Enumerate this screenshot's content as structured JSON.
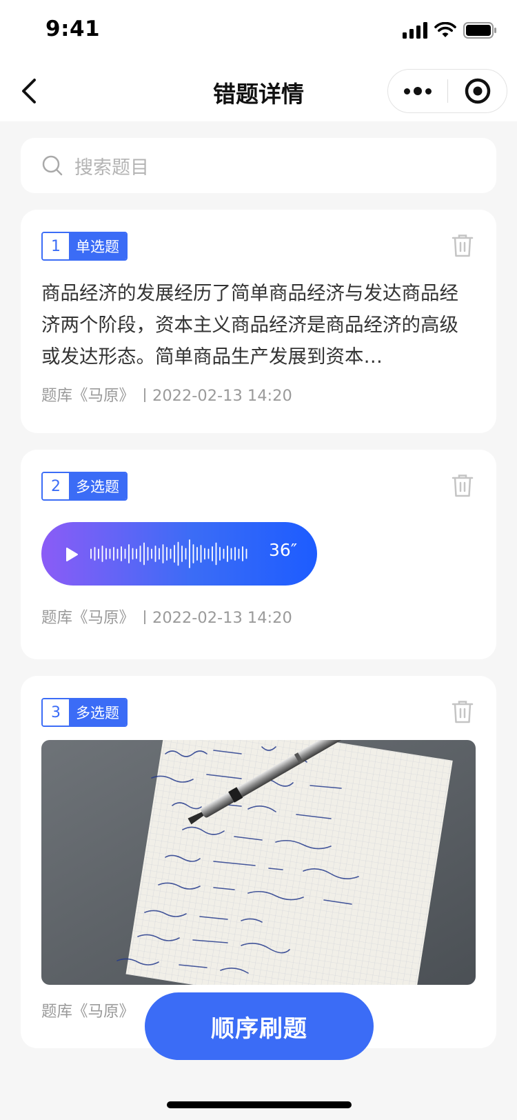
{
  "status_bar": {
    "time": "9:41"
  },
  "nav": {
    "title": "错题详情"
  },
  "search": {
    "placeholder": "搜索题目"
  },
  "cards": [
    {
      "number": "1",
      "type": "单选题",
      "text": "商品经济的发展经历了简单商品经济与发达商品经济两个阶段，资本主义商品经济是商品经济的高级或发达形态。简单商品生产发展到资本…",
      "source": "题库《马原》",
      "time": "2022-02-13 14:20"
    },
    {
      "number": "2",
      "type": "多选题",
      "voice_duration": "36″",
      "source": "题库《马原》",
      "time": "2022-02-13 14:20"
    },
    {
      "number": "3",
      "type": "多选题",
      "image": "handwritten math notes with pen",
      "source": "题库《马原》"
    }
  ],
  "cta": {
    "label": "顺序刷题"
  },
  "colors": {
    "accent": "#3b6cf6",
    "voice_start": "#8b5cf6",
    "voice_end": "#1d5cff",
    "background": "#f6f6f6"
  }
}
